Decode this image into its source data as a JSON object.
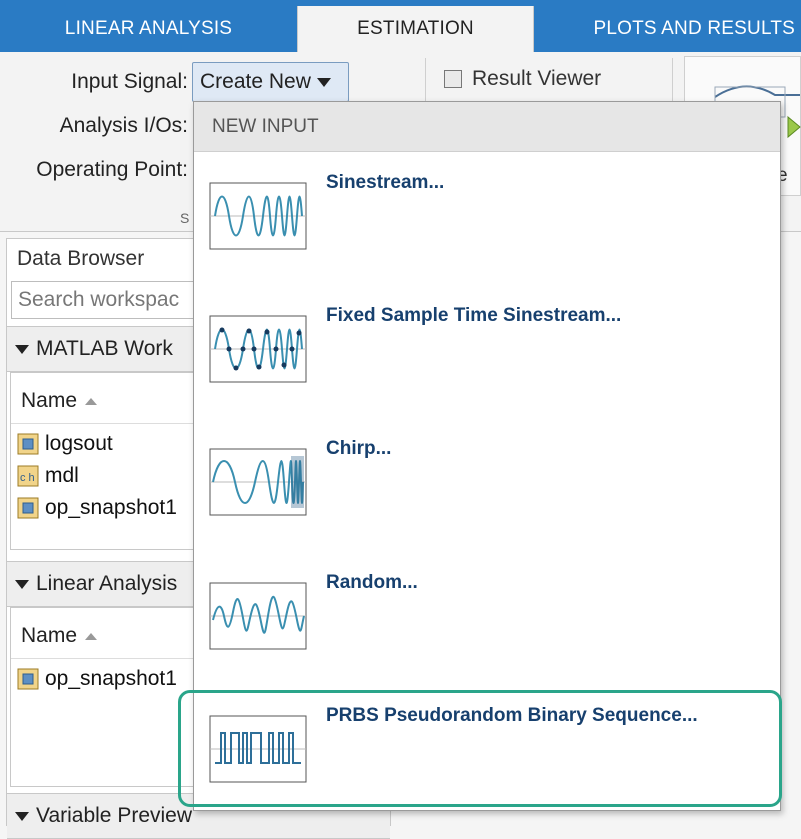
{
  "tabs": [
    "LINEAR ANALYSIS",
    "ESTIMATION",
    "PLOTS AND RESULTS"
  ],
  "active_tab": "ESTIMATION",
  "toolstrip": {
    "input_signal_label": "Input Signal:",
    "input_signal_value": "Create New",
    "analysis_ios_label": "Analysis I/Os:",
    "operating_point_label": "Operating Point:",
    "result_viewer_label": "Result Viewer",
    "section_letter": "S",
    "thumb_partial_text": "e"
  },
  "data_browser": {
    "title": "Data Browser",
    "search_placeholder": "Search workspac",
    "matlab_workspace": {
      "header": "MATLAB Work",
      "column": "Name",
      "items": [
        {
          "name": "logsout",
          "icon": "struct-icon"
        },
        {
          "name": "mdl",
          "icon": "char-icon"
        },
        {
          "name": "op_snapshot1",
          "icon": "struct-icon"
        }
      ]
    },
    "linear_analysis": {
      "header": "Linear Analysis",
      "column": "Name",
      "items": [
        {
          "name": "op_snapshot1",
          "icon": "struct-icon"
        }
      ]
    },
    "variable_preview": {
      "header": "Variable Preview"
    }
  },
  "menu": {
    "header": "NEW INPUT",
    "items": [
      {
        "label": "Sinestream...",
        "icon": "sinestream-icon"
      },
      {
        "label": "Fixed Sample Time Sinestream...",
        "icon": "fixed-sample-sinestream-icon"
      },
      {
        "label": "Chirp...",
        "icon": "chirp-icon"
      },
      {
        "label": "Random...",
        "icon": "random-icon"
      },
      {
        "label": "PRBS Pseudorandom Binary Sequence...",
        "icon": "prbs-icon"
      }
    ]
  },
  "colors": {
    "tab_bar": "#2a7bc4",
    "menu_label": "#17406e",
    "highlight": "#2aa58a",
    "signal_line": "#3a8fb0"
  }
}
